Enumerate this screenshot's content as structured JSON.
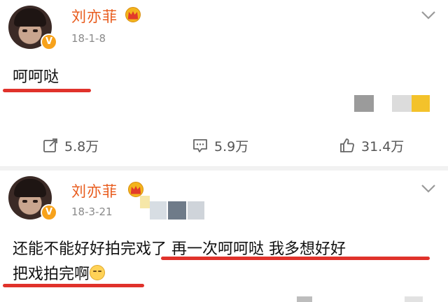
{
  "posts": [
    {
      "author": "刘亦菲",
      "date": "18-1-8",
      "text": "呵呵哒",
      "actions": {
        "repost": "5.8万",
        "comment": "5.9万",
        "like": "31.4万"
      }
    },
    {
      "author": "刘亦菲",
      "date": "18-3-21",
      "text_line1_a": "还能不能好好拍完戏了",
      "text_line1_b": "再一次呵呵哒",
      "text_line1_c": "我多想好好",
      "text_line2": "把戏拍完啊"
    }
  ],
  "icons": {
    "verified": "V",
    "crown": "crown-icon",
    "chevron": "chevron-down-icon",
    "repost": "share-icon",
    "comment": "comment-icon",
    "like": "thumbs-up-icon",
    "emoji": "shy-face-emoji"
  },
  "colors": {
    "author": "#e85a1b",
    "underline": "#e0322b",
    "badge": "#f7a21b"
  }
}
